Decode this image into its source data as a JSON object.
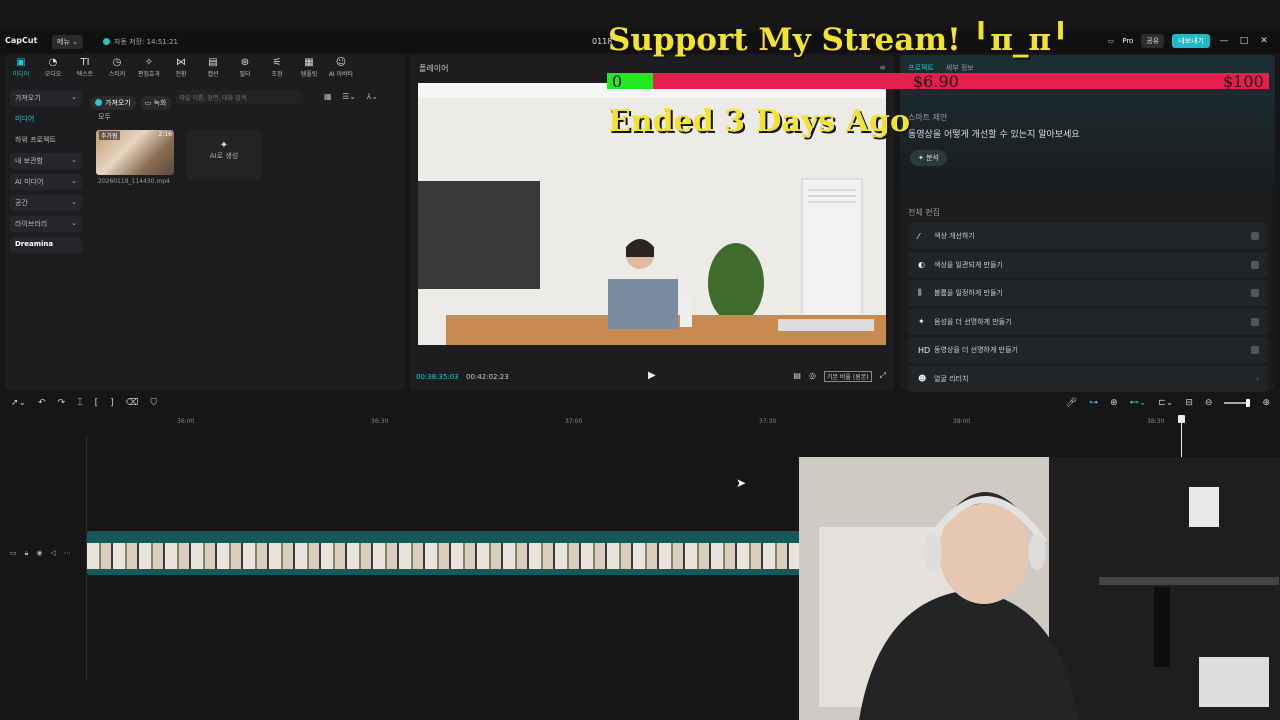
{
  "app": {
    "logo": "CapCut",
    "menu_label": "메뉴 ⌄",
    "autosave": "자동 저장: 14:51:21",
    "project_name": "0118",
    "pro_label": "Pro",
    "share_label": "공유",
    "export_label": "내보내기"
  },
  "tools": [
    {
      "icon": "media-icon",
      "glyph": "▣",
      "label": "미디어",
      "active": true
    },
    {
      "icon": "audio-icon",
      "glyph": "◔",
      "label": "오디오"
    },
    {
      "icon": "text-icon",
      "glyph": "TI",
      "label": "텍스트"
    },
    {
      "icon": "sticker-icon",
      "glyph": "◷",
      "label": "스티커"
    },
    {
      "icon": "effects-icon",
      "glyph": "✧",
      "label": "편집효과"
    },
    {
      "icon": "transition-icon",
      "glyph": "⋈",
      "label": "전환"
    },
    {
      "icon": "caption-icon",
      "glyph": "▤",
      "label": "캡션"
    },
    {
      "icon": "filter-icon",
      "glyph": "⊛",
      "label": "필터"
    },
    {
      "icon": "adjust-icon",
      "glyph": "⚟",
      "label": "조정"
    },
    {
      "icon": "template-icon",
      "glyph": "▦",
      "label": "템플릿"
    },
    {
      "icon": "ai-avatar-icon",
      "glyph": "☺",
      "label": "AI 아바타"
    }
  ],
  "sidebar": [
    {
      "label": "가져오기",
      "caret": "⌄"
    },
    {
      "label": "미디어",
      "plain": true,
      "selected": true
    },
    {
      "label": "하위 프로젝트",
      "plain": true
    },
    {
      "label": "내 보관함",
      "caret": "⌄"
    },
    {
      "label": "AI 미디어",
      "caret": "⌄"
    },
    {
      "label": "공간",
      "caret": "⌄"
    },
    {
      "label": "라이브러리",
      "caret": "⌄"
    },
    {
      "label": "Dreamina",
      "bold": true
    }
  ],
  "media": {
    "import_chip": "가져오기",
    "record_chip": "녹화",
    "search_placeholder": "파일 이름, 장면, 대화 검색",
    "view_icons": "▦ ☰⌄ ⅄⌄",
    "all_label": "모두",
    "clip_added": "추가됨",
    "clip_duration": "2:16",
    "clip_filename": "20260118_114430.mp4",
    "ai_card_label": "AI로 생성"
  },
  "player": {
    "title": "플레이어",
    "current_time": "00:38:35:03",
    "total_time": "00:42:02:23",
    "ratio_label": "기본 비율 (원본)"
  },
  "right_panel": {
    "tabs": [
      "프로젝트",
      "세부 정보"
    ],
    "smart_label": "스마트 제안",
    "smart_text": "동영상을 어떻게 개선할 수 있는지 알아보세요",
    "analyze_label": "분석",
    "edit_label": "전체 편집",
    "edit_items": [
      {
        "icon": "wand-icon",
        "glyph": "⁄",
        "label": "색상 개선하기"
      },
      {
        "icon": "palette-icon",
        "glyph": "◐",
        "label": "색상을 일관되게 만들기"
      },
      {
        "icon": "sliders-icon",
        "glyph": "⫼",
        "label": "볼륨을 일정하게 만들기"
      },
      {
        "icon": "sparkle-icon",
        "glyph": "✦",
        "label": "음성을 더 선명하게 만들기"
      },
      {
        "icon": "hd-icon",
        "glyph": "HD",
        "label": "동영상을 더 선명하게 만들기"
      },
      {
        "icon": "retouch-icon",
        "glyph": "☻",
        "label": "얼굴 리터치",
        "chevron": true
      }
    ]
  },
  "timeline": {
    "ruler": [
      "36:00",
      "36:30",
      "37:00",
      "37:30",
      "38:00",
      "38:30"
    ]
  },
  "overlay": {
    "title": "Support My Stream! ╹π_π╹",
    "goal_start": "0",
    "goal_current": "$6.90",
    "goal_max": "$100",
    "goal_progress": 0.069,
    "ended": "Ended 3 Days Ago"
  },
  "colors": {
    "accent": "#24c8d8",
    "goal_fill": "#22e822",
    "goal_bg": "#e61e4d",
    "overlay_text": "#f3e22f"
  }
}
